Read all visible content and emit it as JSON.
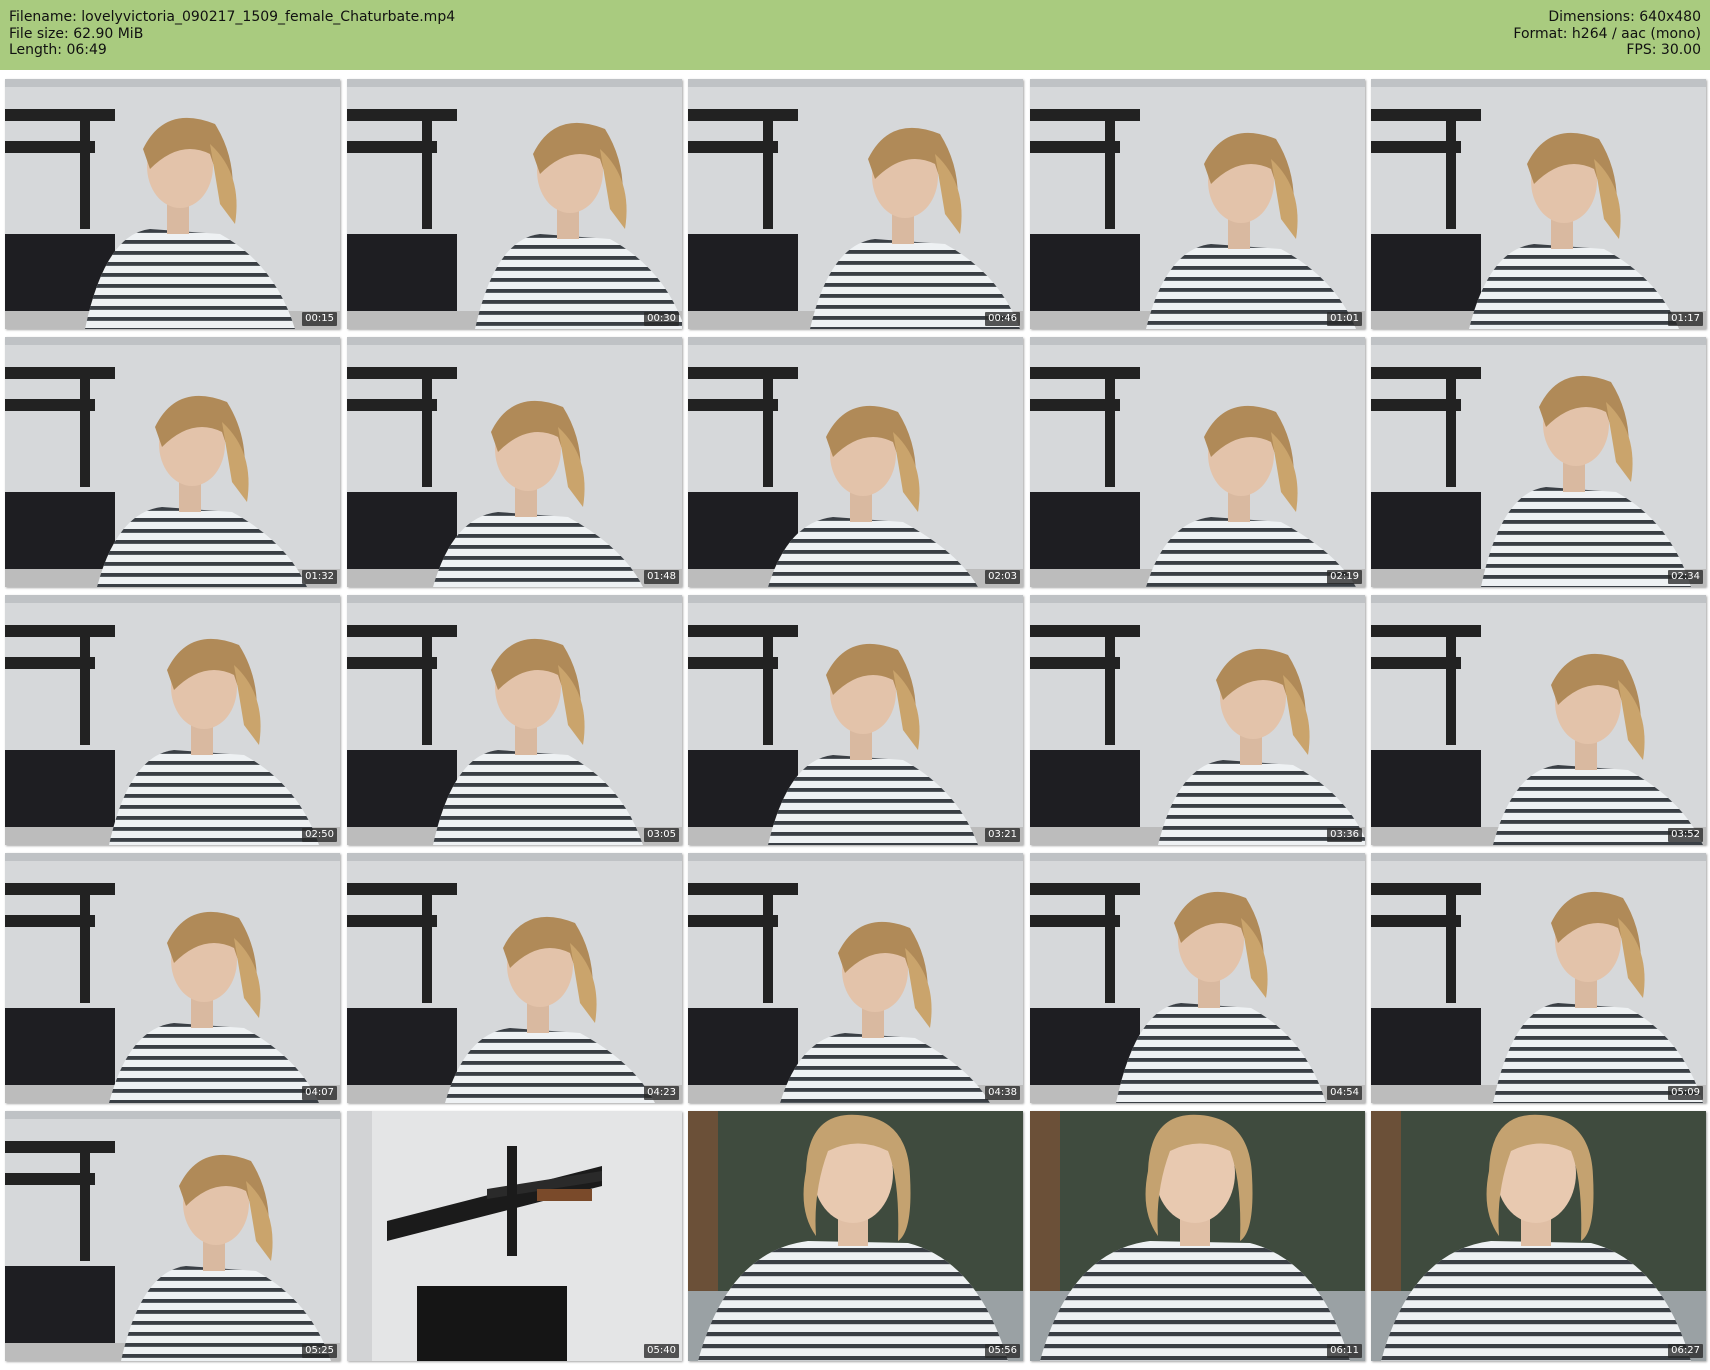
{
  "header": {
    "filename_line": "Filename: lovelyvictoria_090217_1509_female_Chaturbate.mp4",
    "filesize_line": "File size: 62.90 MiB",
    "length_line": "Length: 06:49",
    "dimensions_line": "Dimensions: 640x480",
    "format_line": "Format: h264 / aac (mono)",
    "fps_line": "FPS: 30.00"
  },
  "colors": {
    "header_bg": "#a9cb7f",
    "page_bg": "#ffffff"
  },
  "thumbnails": [
    {
      "timestamp": "00:15",
      "scene": "shelves"
    },
    {
      "timestamp": "00:30",
      "scene": "shelves"
    },
    {
      "timestamp": "00:46",
      "scene": "shelves"
    },
    {
      "timestamp": "01:01",
      "scene": "shelves"
    },
    {
      "timestamp": "01:17",
      "scene": "shelves"
    },
    {
      "timestamp": "01:32",
      "scene": "shelves"
    },
    {
      "timestamp": "01:48",
      "scene": "shelves"
    },
    {
      "timestamp": "02:03",
      "scene": "shelves"
    },
    {
      "timestamp": "02:19",
      "scene": "shelves"
    },
    {
      "timestamp": "02:34",
      "scene": "shelves"
    },
    {
      "timestamp": "02:50",
      "scene": "shelves"
    },
    {
      "timestamp": "03:05",
      "scene": "shelves"
    },
    {
      "timestamp": "03:21",
      "scene": "shelves"
    },
    {
      "timestamp": "03:36",
      "scene": "shelves"
    },
    {
      "timestamp": "03:52",
      "scene": "shelves"
    },
    {
      "timestamp": "04:07",
      "scene": "shelves"
    },
    {
      "timestamp": "04:23",
      "scene": "shelves"
    },
    {
      "timestamp": "04:38",
      "scene": "shelves"
    },
    {
      "timestamp": "04:54",
      "scene": "shelves"
    },
    {
      "timestamp": "05:09",
      "scene": "shelves"
    },
    {
      "timestamp": "05:25",
      "scene": "shelves"
    },
    {
      "timestamp": "05:40",
      "scene": "empty-room"
    },
    {
      "timestamp": "05:56",
      "scene": "green-wall"
    },
    {
      "timestamp": "06:11",
      "scene": "green-wall"
    },
    {
      "timestamp": "06:27",
      "scene": "green-wall"
    }
  ]
}
